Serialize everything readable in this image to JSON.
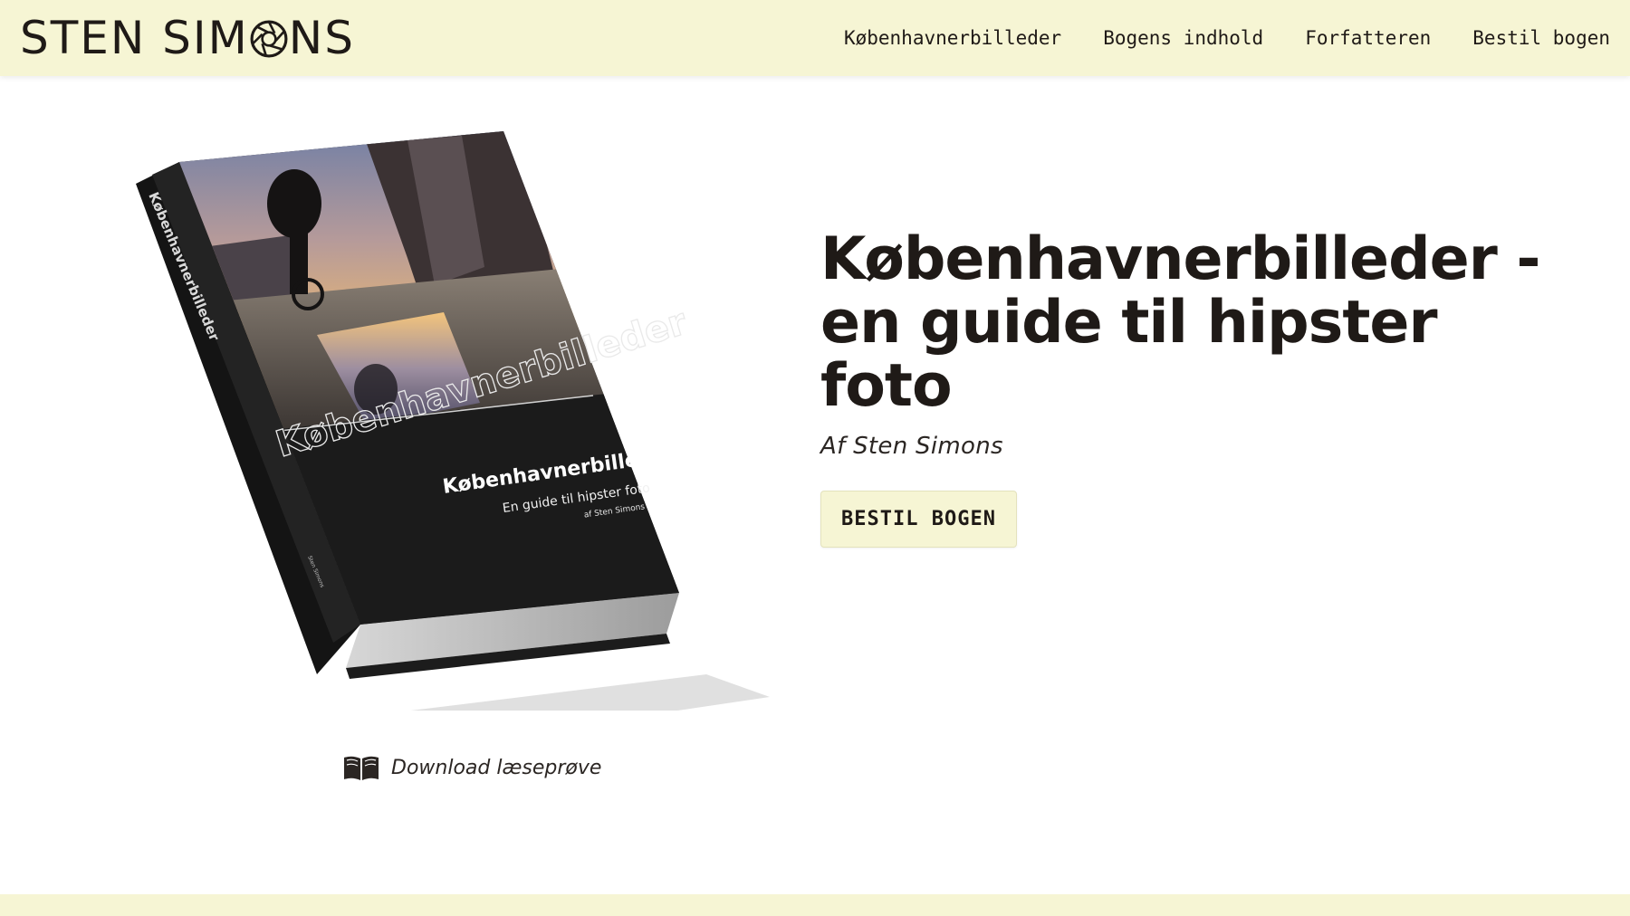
{
  "header": {
    "logo_left": "STEN SIM",
    "logo_right": "NS",
    "nav": [
      {
        "label": "Københavnerbilleder"
      },
      {
        "label": "Bogens indhold"
      },
      {
        "label": "Forfatteren"
      },
      {
        "label": "Bestil bogen"
      }
    ]
  },
  "book_cover": {
    "spine_text": "Københavnerbilleder",
    "big_title": "Københavnerbilleder",
    "title": "Københavnerbilleder",
    "subtitle": "En guide til hipster foto",
    "byline": "af Sten Simons",
    "spine_author": "Sten Simons"
  },
  "download": {
    "label": "Download læseprøve",
    "icon": "open-book-icon"
  },
  "hero": {
    "title": "Københavnerbilleder - en guide til hipster foto",
    "author": "Af Sten Simons",
    "order_button": "BESTIL BOGEN"
  },
  "colors": {
    "header_bg": "#f6f5d4",
    "text": "#1f1a17",
    "button_bg": "#f6f5d4"
  }
}
